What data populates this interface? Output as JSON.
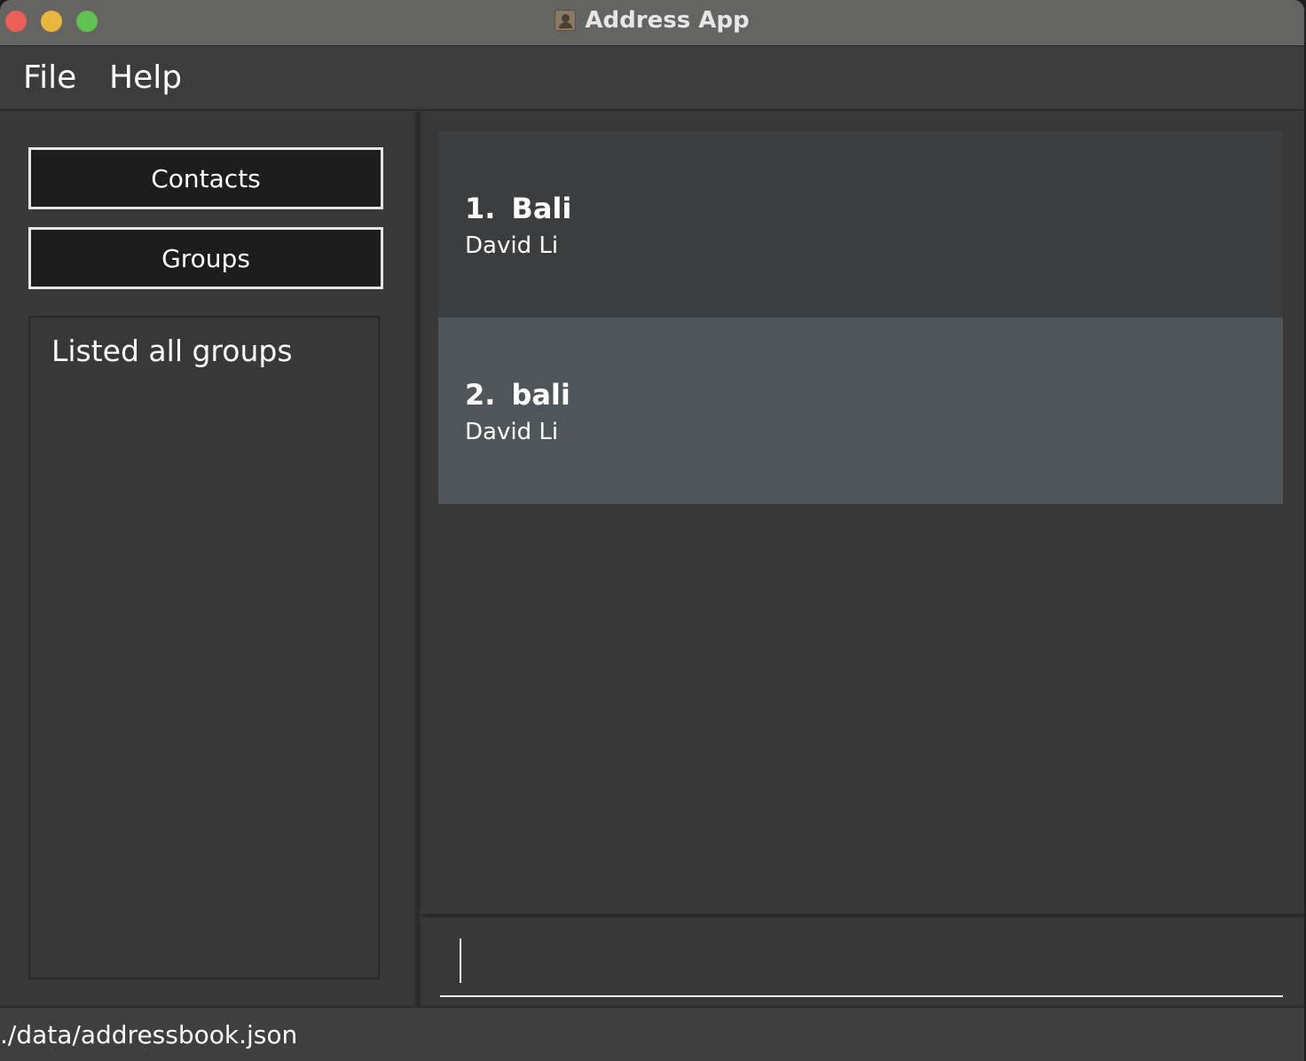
{
  "window": {
    "title": "Address App"
  },
  "menu": {
    "file": "File",
    "help": "Help"
  },
  "sidebar": {
    "contacts_label": "Contacts",
    "groups_label": "Groups",
    "result_message": "Listed all groups"
  },
  "groups": [
    {
      "index": "1.",
      "name": "Bali",
      "members": "David Li",
      "selected": false
    },
    {
      "index": "2.",
      "name": "bali",
      "members": "David Li",
      "selected": true
    }
  ],
  "command": {
    "value": "",
    "placeholder": ""
  },
  "status": {
    "path": "./data/addressbook.json"
  }
}
